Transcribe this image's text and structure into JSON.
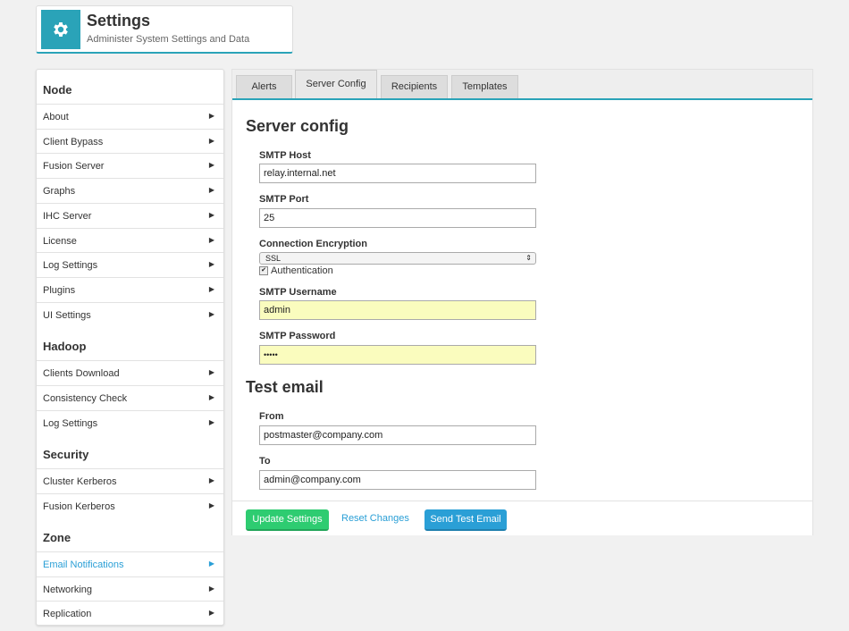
{
  "header": {
    "title": "Settings",
    "subtitle": "Administer System Settings and Data",
    "icon": "gear-icon",
    "accent": "#2aa3b8"
  },
  "sidebar": {
    "sections": [
      {
        "title": "Node",
        "items": [
          "About",
          "Client Bypass",
          "Fusion Server",
          "Graphs",
          "IHC Server",
          "License",
          "Log Settings",
          "Plugins",
          "UI Settings"
        ]
      },
      {
        "title": "Hadoop",
        "items": [
          "Clients Download",
          "Consistency Check",
          "Log Settings"
        ]
      },
      {
        "title": "Security",
        "items": [
          "Cluster Kerberos",
          "Fusion Kerberos"
        ]
      },
      {
        "title": "Zone",
        "items": [
          "Email Notifications",
          "Networking",
          "Replication"
        ]
      }
    ],
    "active_item": "Email Notifications",
    "arrow_icon": "caret-right-icon"
  },
  "tabs": [
    "Alerts",
    "Server Config",
    "Recipients",
    "Templates"
  ],
  "selected_tab": "Server Config",
  "server_config": {
    "heading": "Server config",
    "smtp_host_label": "SMTP Host",
    "smtp_host_value": "relay.internal.net",
    "smtp_port_label": "SMTP Port",
    "smtp_port_value": "25",
    "encryption_label": "Connection Encryption",
    "encryption_value": "SSL",
    "auth_label": "Authentication",
    "auth_checked": true,
    "username_label": "SMTP Username",
    "username_value": "admin",
    "password_label": "SMTP Password",
    "password_value": "•••••"
  },
  "test_email": {
    "heading": "Test email",
    "from_label": "From",
    "from_value": "postmaster@company.com",
    "to_label": "To",
    "to_value": "admin@company.com"
  },
  "actions": {
    "update": "Update Settings",
    "reset": "Reset Changes",
    "send_test": "Send Test Email"
  },
  "colors": {
    "green": "#2ecc71",
    "blue": "#2a9fd6",
    "autofill": "#fafcbe"
  }
}
